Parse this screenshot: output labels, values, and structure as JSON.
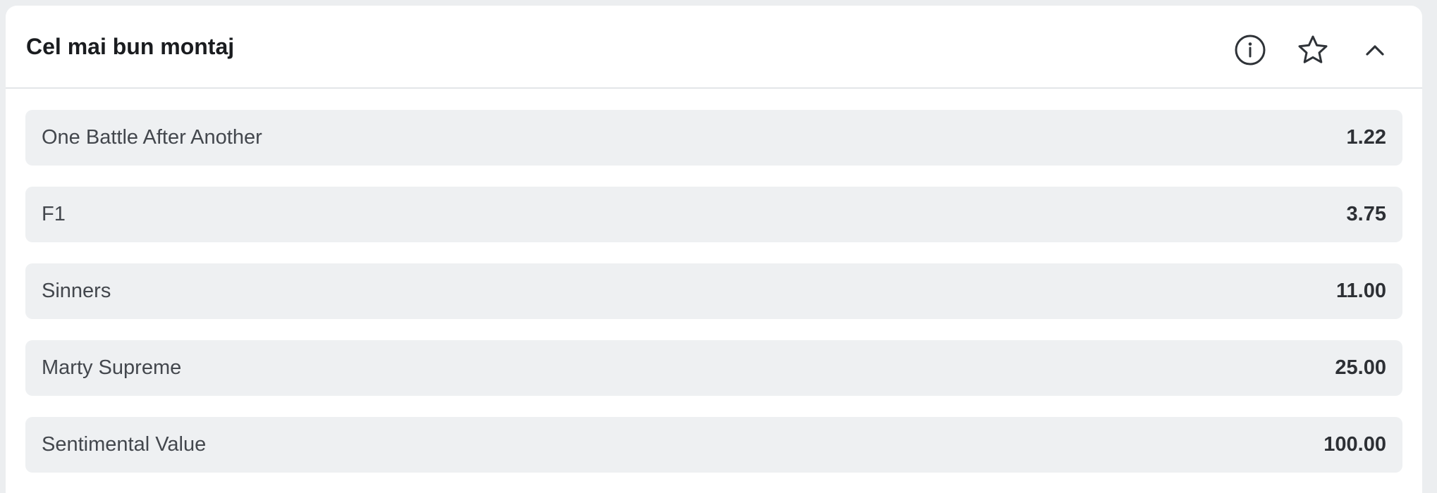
{
  "market": {
    "title": "Cel mai bun montaj",
    "actions": {
      "info_icon": "info-circle-icon",
      "favorite_icon": "star-outline-icon",
      "collapse_icon": "chevron-up-icon"
    },
    "selections": [
      {
        "name": "One Battle After Another",
        "odds": "1.22"
      },
      {
        "name": "F1",
        "odds": "3.75"
      },
      {
        "name": "Sinners",
        "odds": "11.00"
      },
      {
        "name": "Marty Supreme",
        "odds": "25.00"
      },
      {
        "name": "Sentimental Value",
        "odds": "100.00"
      }
    ]
  },
  "colors": {
    "page_background": "#eceef0",
    "card_background": "#ffffff",
    "row_background": "#eef0f2",
    "title_text": "#1a1c1f",
    "name_text": "#43474d",
    "odds_text": "#2d3035",
    "icon_stroke": "#2f3338"
  }
}
